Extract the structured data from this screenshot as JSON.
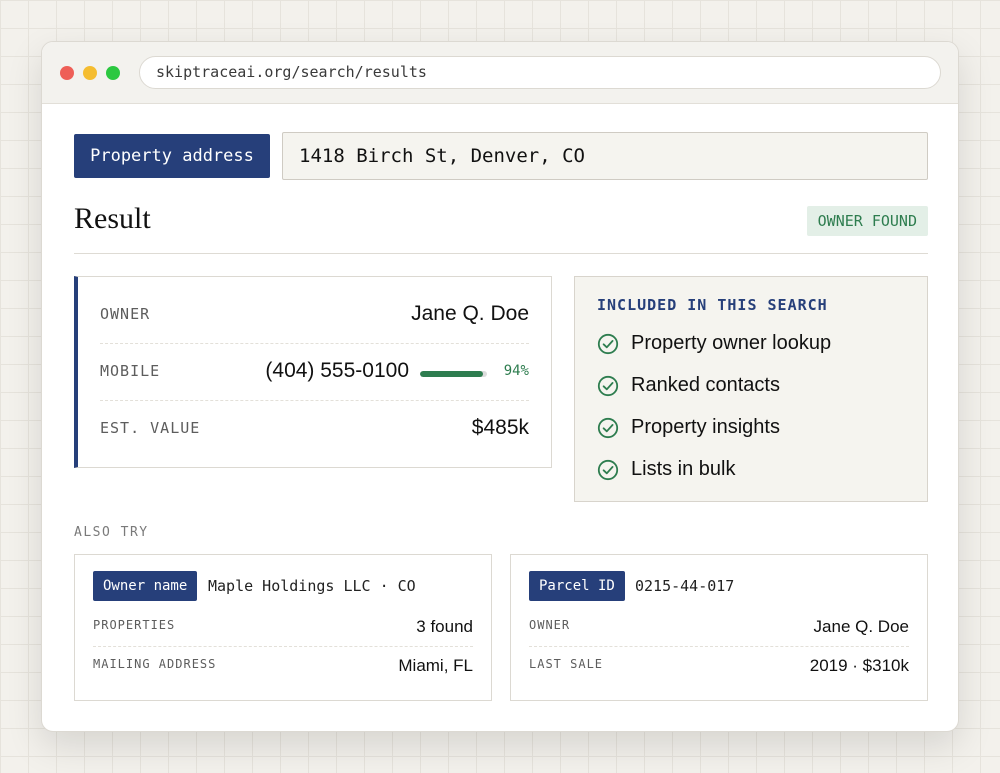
{
  "browser": {
    "url": "skiptraceai.org/search/results"
  },
  "search": {
    "label": "Property address",
    "value": "1418 Birch St, Denver, CO"
  },
  "result": {
    "title": "Result",
    "status_badge": "OWNER FOUND",
    "status_color": "#2e7d4f"
  },
  "owner_card": {
    "rows": [
      {
        "label": "OWNER",
        "value": "Jane Q. Doe"
      },
      {
        "label": "MOBILE",
        "value": "(404) 555-0100",
        "confidence": 94,
        "confidence_text": "94%"
      },
      {
        "label": "EST. VALUE",
        "value": "$485k"
      }
    ]
  },
  "included": {
    "title": "INCLUDED IN THIS SEARCH",
    "icon": "check-circle-icon",
    "items": [
      "Property owner lookup",
      "Ranked contacts",
      "Property insights",
      "Lists in bulk"
    ]
  },
  "also_try": {
    "label": "ALSO TRY",
    "cards": [
      {
        "tag": "Owner name",
        "query": "Maple Holdings LLC · CO",
        "rows": [
          {
            "label": "PROPERTIES",
            "value": "3 found"
          },
          {
            "label": "MAILING ADDRESS",
            "value": "Miami, FL"
          }
        ]
      },
      {
        "tag": "Parcel ID",
        "query": "0215-44-017",
        "rows": [
          {
            "label": "OWNER",
            "value": "Jane Q. Doe"
          },
          {
            "label": "LAST SALE",
            "value": "2019 · $310k"
          }
        ]
      }
    ]
  },
  "colors": {
    "accent": "#263f7a",
    "success": "#2e7d4f",
    "window_close": "#ee5f57",
    "window_minimize": "#f5bd30",
    "window_maximize": "#2bc840"
  }
}
